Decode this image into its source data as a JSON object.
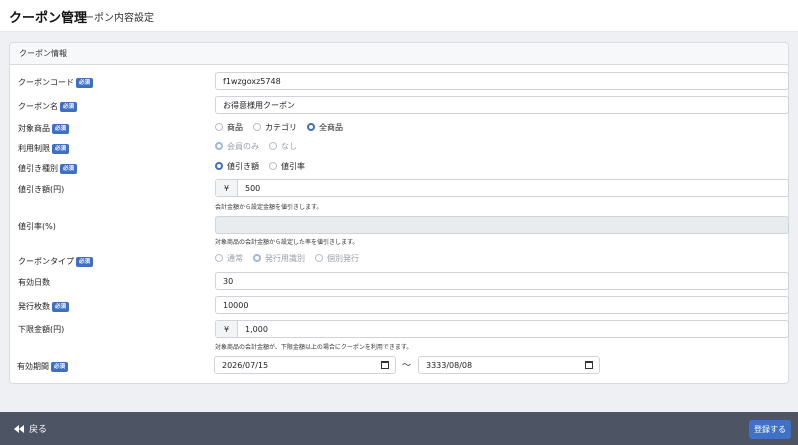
{
  "header": {
    "title": "クーポン管理",
    "subtitle": "クーポン内容設定"
  },
  "card": {
    "title": "クーポン情報"
  },
  "required_label": "必須",
  "fields": {
    "coupon_code": {
      "label": "クーポンコード",
      "value": "f1wzgoxz5748"
    },
    "coupon_name": {
      "label": "クーポン名",
      "value": "お得意様用クーポン"
    },
    "target": {
      "label": "対象商品",
      "options": [
        "商品",
        "カテゴリ",
        "全商品"
      ],
      "selected": "全商品"
    },
    "usage_limit": {
      "label": "利用制限",
      "options": [
        "会員のみ",
        "なし"
      ],
      "selected": "会員のみ"
    },
    "discount_type": {
      "label": "値引き種別",
      "options": [
        "値引き額",
        "値引率"
      ],
      "selected": "値引き額"
    },
    "discount_amount": {
      "label": "値引き額(円)",
      "prefix": "¥",
      "value": "500",
      "help": "会計金額から設定金額を値引きします。"
    },
    "discount_rate": {
      "label": "値引率(%)",
      "value": "",
      "help": "対象商品の会計金額から設定した率を値引きします。"
    },
    "coupon_type": {
      "label": "クーポンタイプ",
      "options": [
        "通常",
        "発行用識別",
        "個別発行"
      ],
      "selected": "発行用識別"
    },
    "valid_days": {
      "label": "有効日数",
      "value": "30"
    },
    "issue_count": {
      "label": "発行枚数",
      "value": "10000"
    },
    "min_amount": {
      "label": "下限金額(円)",
      "prefix": "¥",
      "value": "1,000",
      "help": "対象商品の会計金額が、下限金額以上の場合にクーポンを利用できます。"
    },
    "valid_period": {
      "label": "有効期間",
      "start": "2026/07/15",
      "separator": "〜",
      "end": "3333/08/08"
    }
  },
  "footer": {
    "back_label": "戻る",
    "save_label": "登録する"
  },
  "colors": {
    "accent": "#3f72c6",
    "badge": "#3f6fc4",
    "footer": "#4d5564"
  }
}
